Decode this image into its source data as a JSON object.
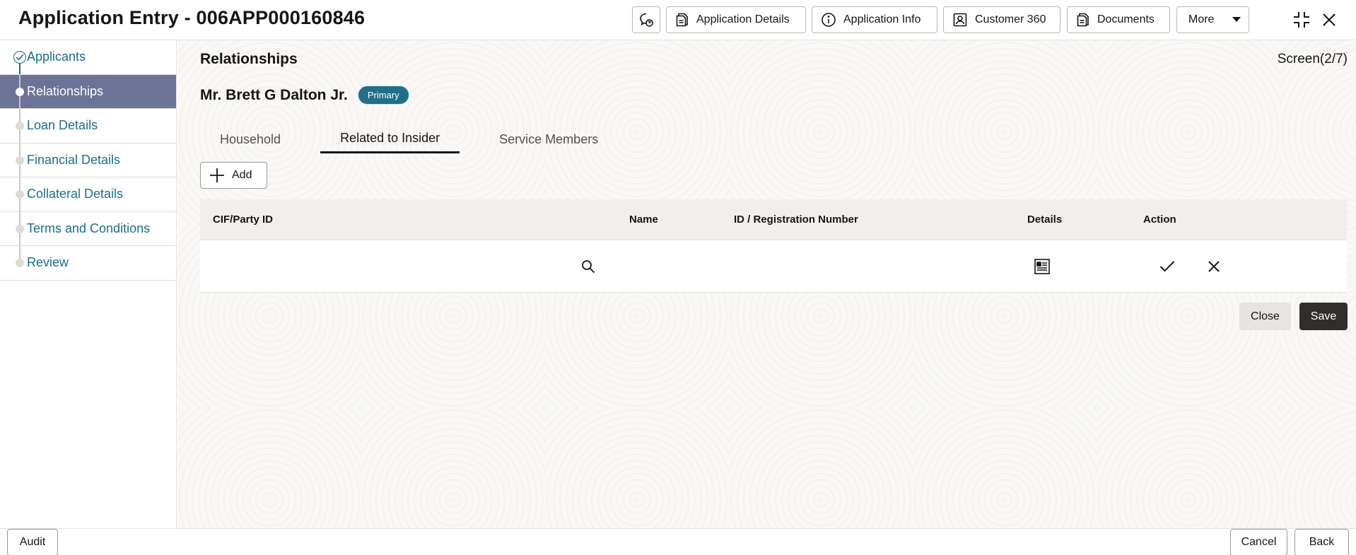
{
  "header": {
    "title": "Application Entry - 006APP000160846",
    "buttons": {
      "application_details": "Application Details",
      "application_info": "Application Info",
      "customer_360": "Customer 360",
      "documents": "Documents",
      "more": "More"
    }
  },
  "sidebar": {
    "items": [
      {
        "label": "Applicants",
        "state": "completed"
      },
      {
        "label": "Relationships",
        "state": "active"
      },
      {
        "label": "Loan Details",
        "state": "pending"
      },
      {
        "label": "Financial Details",
        "state": "pending"
      },
      {
        "label": "Collateral Details",
        "state": "pending"
      },
      {
        "label": "Terms and Conditions",
        "state": "pending"
      },
      {
        "label": "Review",
        "state": "pending"
      }
    ]
  },
  "main": {
    "section_title": "Relationships",
    "screen_indicator": "Screen(2/7)",
    "customer_name": "Mr. Brett G Dalton Jr.",
    "customer_badge": "Primary",
    "tabs": [
      {
        "label": "Household"
      },
      {
        "label": "Related to Insider"
      },
      {
        "label": "Service Members"
      }
    ],
    "active_tab": "Related to Insider",
    "add_label": "Add",
    "table": {
      "columns": [
        "CIF/Party ID",
        "Name",
        "ID / Registration Number",
        "Details",
        "Action"
      ]
    },
    "close_label": "Close",
    "save_label": "Save"
  },
  "footer": {
    "audit": "Audit",
    "cancel": "Cancel",
    "back": "Back"
  },
  "colors": {
    "accent": "#1b6d8c",
    "nav_active": "#6c7396",
    "badge": "#1f6f88",
    "primary_button": "#312d2a"
  },
  "icons": [
    "chat-help-icon",
    "document-icon",
    "info-icon",
    "user-card-icon",
    "chevron-down-icon",
    "minimize-icon",
    "close-icon",
    "check-circle-icon",
    "plus-icon",
    "search-icon",
    "details-icon",
    "check-icon",
    "x-icon"
  ]
}
